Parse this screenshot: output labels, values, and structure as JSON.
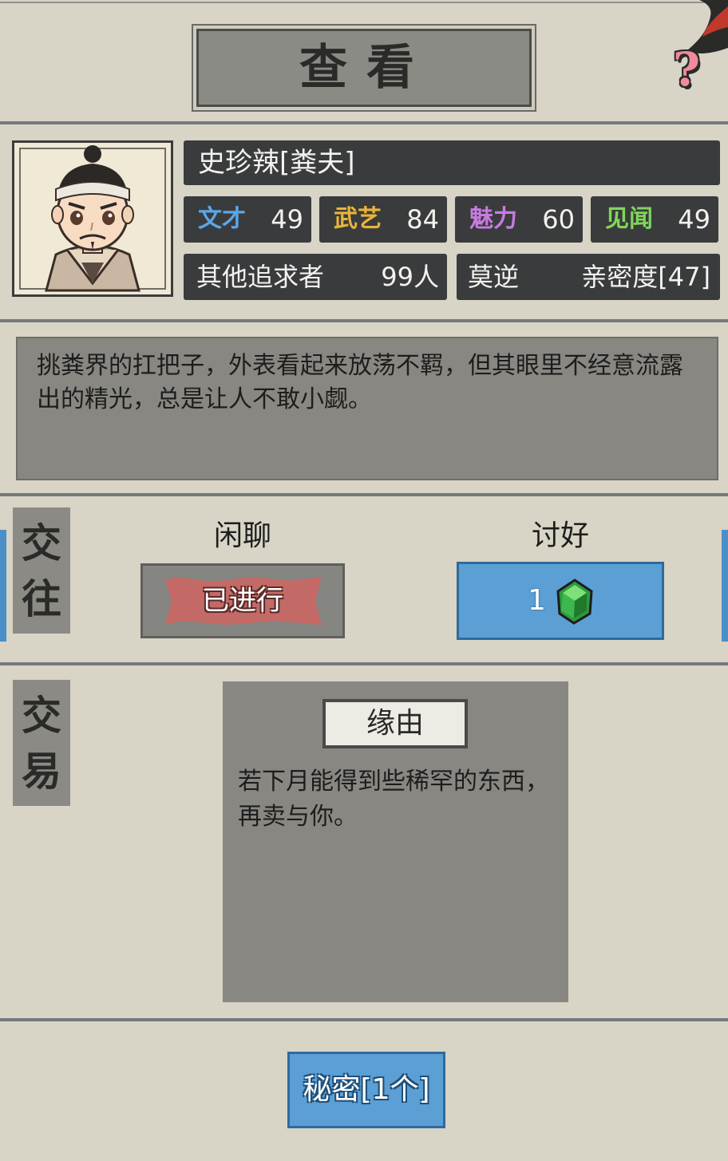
{
  "header": {
    "title": "查看",
    "help_symbol": "?"
  },
  "character": {
    "name": "史珍辣[粪夫]",
    "stats": [
      {
        "label": "文才",
        "value": "49",
        "color": "#5aa7e8"
      },
      {
        "label": "武艺",
        "value": "84",
        "color": "#e8b43c"
      },
      {
        "label": "魅力",
        "value": "60",
        "color": "#c77be0"
      },
      {
        "label": "见闻",
        "value": "49",
        "color": "#7fd65a"
      }
    ],
    "suitors_label": "其他追求者",
    "suitors_value": "99人",
    "relation_name": "莫逆",
    "intimacy": "亲密度[47]",
    "description": "挑粪界的扛把子，外表看起来放荡不羁，但其眼里不经意流露出的精光，总是让人不敢小觑。"
  },
  "interaction": {
    "section_label": "交往",
    "chat": {
      "label": "闲聊",
      "button_text": "已进行"
    },
    "flatter": {
      "label": "讨好",
      "cost": "1",
      "cost_icon": "green-gem-icon"
    }
  },
  "trade": {
    "section_label": "交易",
    "reason_title": "缘由",
    "reason_text": "若下月能得到些稀罕的东西，再卖与你。"
  },
  "secret_button": "秘密[1个]"
}
